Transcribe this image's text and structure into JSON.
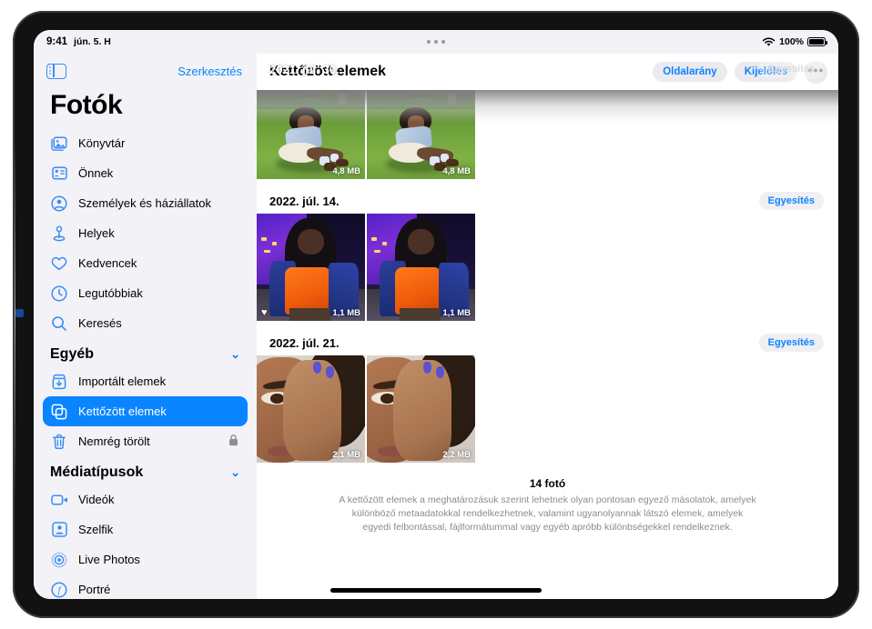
{
  "status_bar": {
    "time": "9:41",
    "date": "jún. 5. H",
    "battery_percent": "100%",
    "wifi_icon": "wifi-icon",
    "battery_icon": "battery-icon",
    "multitask_dots": "multitasking-indicator"
  },
  "sidebar": {
    "toggle_icon": "sidebar-toggle-icon",
    "edit_label": "Szerkesztés",
    "title": "Fotók",
    "primary_items": [
      {
        "label": "Könyvtár",
        "icon": "library-icon"
      },
      {
        "label": "Önnek",
        "icon": "for-you-icon"
      },
      {
        "label": "Személyek és háziállatok",
        "icon": "people-pets-icon"
      },
      {
        "label": "Helyek",
        "icon": "places-pin-icon"
      },
      {
        "label": "Kedvencek",
        "icon": "heart-icon"
      },
      {
        "label": "Legutóbbiak",
        "icon": "clock-icon"
      },
      {
        "label": "Keresés",
        "icon": "search-icon"
      }
    ],
    "other_section": {
      "header": "Egyéb",
      "chevron": "chevron-down-icon",
      "items": [
        {
          "label": "Importált elemek",
          "icon": "import-icon",
          "selected": false,
          "locked": false
        },
        {
          "label": "Kettőzött elemek",
          "icon": "duplicates-icon",
          "selected": true,
          "locked": false
        },
        {
          "label": "Nemrég törölt",
          "icon": "trash-icon",
          "selected": false,
          "locked": true,
          "lock_icon": "lock-icon"
        }
      ]
    },
    "media_section": {
      "header": "Médiatípusok",
      "chevron": "chevron-down-icon",
      "items": [
        {
          "label": "Videók",
          "icon": "video-icon"
        },
        {
          "label": "Szelfik",
          "icon": "selfie-icon"
        },
        {
          "label": "Live Photos",
          "icon": "live-photos-icon"
        },
        {
          "label": "Portré",
          "icon": "portrait-icon"
        }
      ]
    }
  },
  "main": {
    "title": "Kettőzött elemek",
    "toolbar": {
      "aspect_ratio_label": "Oldalarány",
      "select_label": "Kijelölés",
      "more_label": "•••",
      "more_icon": "ellipsis-icon"
    },
    "groups": [
      {
        "date": "2021. júl. 30.",
        "merge_label": "Egyesítés",
        "scrolled_under": true,
        "photos": [
          {
            "size": "4,8 MB",
            "favorite": false,
            "scene": "A"
          },
          {
            "size": "4,8 MB",
            "favorite": false,
            "scene": "A"
          }
        ]
      },
      {
        "date": "2022. júl. 14.",
        "merge_label": "Egyesítés",
        "scrolled_under": false,
        "photos": [
          {
            "size": "1,1 MB",
            "favorite": true,
            "scene": "B"
          },
          {
            "size": "1,1 MB",
            "favorite": false,
            "scene": "B"
          }
        ]
      },
      {
        "date": "2022. júl. 21.",
        "merge_label": "Egyesítés",
        "scrolled_under": false,
        "photos": [
          {
            "size": "2,1 MB",
            "favorite": false,
            "scene": "C"
          },
          {
            "size": "2,2 MB",
            "favorite": false,
            "scene": "C"
          }
        ]
      }
    ],
    "footer": {
      "count": "14 fotó",
      "description": "A kettőzött elemek a meghatározásuk szerint lehetnek olyan pontosan egyező másolatok, amelyek különböző metaadatokkal rendelkezhetnek, valamint ugyanolyannak látszó elemek, amelyek egyedi felbontással, fájlformátummal vagy egyéb apróbb különbségekkel rendelkeznek."
    }
  },
  "colors": {
    "accent_blue": "#0a84ff",
    "sidebar_bg": "#f2f2f7",
    "selected_row": "#0a84ff",
    "pill_bg": "#eceaee",
    "footer_text": "#8b8b90"
  },
  "home_indicator": "home-indicator"
}
